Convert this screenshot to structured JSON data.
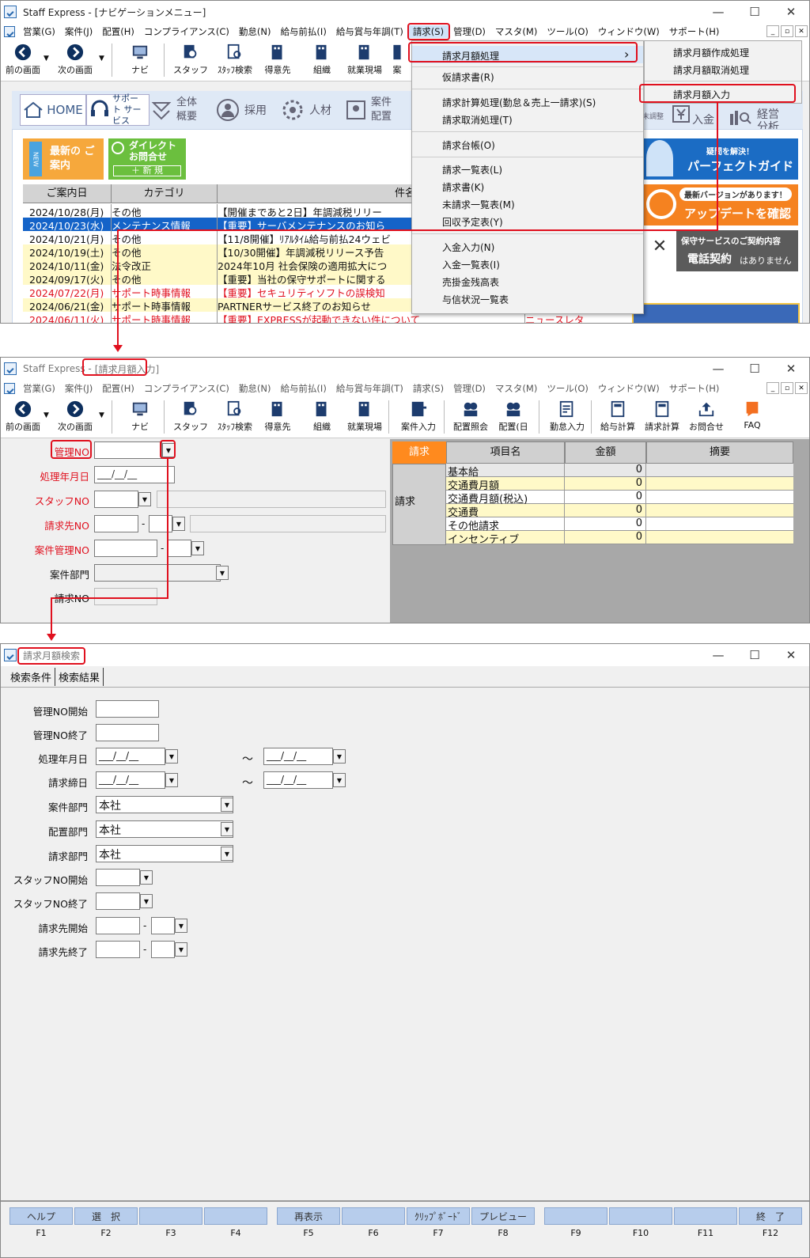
{
  "app": {
    "title_nav": "Staff Express - [ナビゲーションメニュー]",
    "title_prefix": "Staff Express -",
    "title_input": "[請求月額入力]",
    "title_search": "請求月額検索"
  },
  "win_controls": {
    "min": "—",
    "max": "☐",
    "close": "✕"
  },
  "mdi_controls": [
    "_",
    "▫",
    "✕"
  ],
  "menu": [
    "営業(G)",
    "案件(J)",
    "配置(H)",
    "コンプライアンス(C)",
    "勤怠(N)",
    "給与前払(I)",
    "給与賞与年調(T)",
    "請求(S)",
    "管理(D)",
    "マスタ(M)",
    "ツール(O)",
    "ウィンドウ(W)",
    "サポート(H)"
  ],
  "toolbar": {
    "back": "前の画面",
    "forward": "次の画面",
    "navi": "ナビ",
    "staff": "スタッフ",
    "staff_search": "ｽﾀｯﾌ検索",
    "client": "得意先",
    "org": "組織",
    "site": "就業現場",
    "case_cut": "案",
    "case_input": "案件入力",
    "assign_ref": "配置照会",
    "assign_day": "配置(日",
    "attendance_input": "勤怠入力",
    "pay_calc": "給与計算",
    "bill_calc": "請求計算",
    "inquiry": "お問合せ",
    "faq": "FAQ"
  },
  "nav_tabs": {
    "home": "HOME",
    "support": "サポート サービス",
    "overview": "全体 概要",
    "recruit": "採用",
    "hr": "人材",
    "case": "案件 配置",
    "year_adjust": "年末調整",
    "payment": "入金",
    "analysis": "経営 分析"
  },
  "news": {
    "new_badge": "NEW",
    "latest": "最新の ご案内",
    "direct": "ダイレクト お問合せ",
    "new_button": "＋ 新 規",
    "headers": [
      "ご案内日",
      "カテゴリ",
      "件名"
    ],
    "rows": [
      {
        "date": "2024/10/28(月)",
        "cat": "その他",
        "subject": "【開催まであと2日】年調減税リリー"
      },
      {
        "date": "2024/10/23(水)",
        "cat": "メンテナンス情報",
        "subject": "【重要】サーバメンテナンスのお知ら"
      },
      {
        "date": "2024/10/21(月)",
        "cat": "その他",
        "subject": "【11/8開催】ﾘｱﾙﾀｲﾑ給与前払24ウェビ"
      },
      {
        "date": "2024/10/19(土)",
        "cat": "その他",
        "subject": "【10/30開催】年調減税リリース予告"
      },
      {
        "date": "2024/10/11(金)",
        "cat": "法令改正",
        "subject": "2024年10月 社会保険の適用拡大につ"
      },
      {
        "date": "2024/09/17(火)",
        "cat": "その他",
        "subject": "【重要】当社の保守サポートに関する"
      },
      {
        "date": "2024/07/22(月)",
        "cat": "サポート時事情報",
        "subject": "【重要】セキュリティソフトの誤検知"
      },
      {
        "date": "2024/06/21(金)",
        "cat": "サポート時事情報",
        "subject": "PARTNERサービス終了のお知らせ"
      },
      {
        "date": "2024/06/11(火)",
        "cat": "サポート時事情報",
        "subject": "【重要】EXPRESSが起動できない件について"
      }
    ],
    "row_extra": "ニュースレタ"
  },
  "banners": {
    "guide_small": "疑問を解決！",
    "guide_big": "パーフェクトガイド",
    "update_small": "最新バージョンがあります！",
    "update_big": "アップデートを確認",
    "contract_line1": "保守サービスのご契約内容",
    "contract_line2": "電話契約",
    "contract_line3": "はありません"
  },
  "dropdown": [
    "請求月額処理",
    "仮請求書(R)",
    "請求計算処理(勤怠＆売上一請求)(S)",
    "請求取消処理(T)",
    "請求台帳(O)",
    "請求一覧表(L)",
    "請求書(K)",
    "未請求一覧表(M)",
    "回収予定表(Y)",
    "入金入力(N)",
    "入金一覧表(I)",
    "売掛金残高表",
    "与信状況一覧表"
  ],
  "dropdown_arrow": "›",
  "submenu": [
    "請求月額作成処理",
    "請求月額取消処理",
    "請求月額入力"
  ],
  "form2": {
    "labels": [
      "管理NO",
      "処理年月日",
      "スタッフNO",
      "請求先NO",
      "案件管理NO",
      "案件部門",
      "請求NO"
    ],
    "date_placeholder": "___/__/__",
    "dash": "-",
    "table_tab": "請求",
    "headers": [
      "項目名",
      "金額",
      "摘要"
    ],
    "group": "請求",
    "rows": [
      {
        "name": "基本給",
        "amount": "0"
      },
      {
        "name": "交通費月額",
        "amount": "0"
      },
      {
        "name": "交通費月額(税込)",
        "amount": "0"
      },
      {
        "name": "交通費",
        "amount": "0"
      },
      {
        "name": "その他請求",
        "amount": "0"
      },
      {
        "name": "インセンティブ",
        "amount": "0"
      }
    ]
  },
  "search": {
    "tabs": [
      "検索条件",
      "検索結果"
    ],
    "labels": [
      "管理NO開始",
      "管理NO終了",
      "処理年月日",
      "請求締日",
      "案件部門",
      "配置部門",
      "請求部門",
      "スタッフNO開始",
      "スタッフNO終了",
      "請求先開始",
      "請求先終了"
    ],
    "dept_value": "本社",
    "tilde": "〜",
    "date_placeholder": "___/__/__",
    "dash": "-"
  },
  "fkeys": [
    {
      "label": "ヘルプ",
      "key": "F1"
    },
    {
      "label": "選　択",
      "key": "F2"
    },
    {
      "label": "",
      "key": "F3"
    },
    {
      "label": "",
      "key": "F4"
    },
    {
      "label": "再表示",
      "key": "F5"
    },
    {
      "label": "",
      "key": "F6"
    },
    {
      "label": "ｸﾘｯﾌﾟﾎﾞｰﾄﾞ",
      "key": "F7"
    },
    {
      "label": "プレビュー",
      "key": "F8"
    },
    {
      "label": "",
      "key": "F9"
    },
    {
      "label": "",
      "key": "F10"
    },
    {
      "label": "",
      "key": "F11"
    },
    {
      "label": "終　了",
      "key": "F12"
    }
  ],
  "colors": {
    "highlight": "#e0101e",
    "selected_row": "#1463c8",
    "yellow_row": "#fff9c8",
    "orange": "#ff8a1e",
    "fkey": "#b7cdec"
  }
}
